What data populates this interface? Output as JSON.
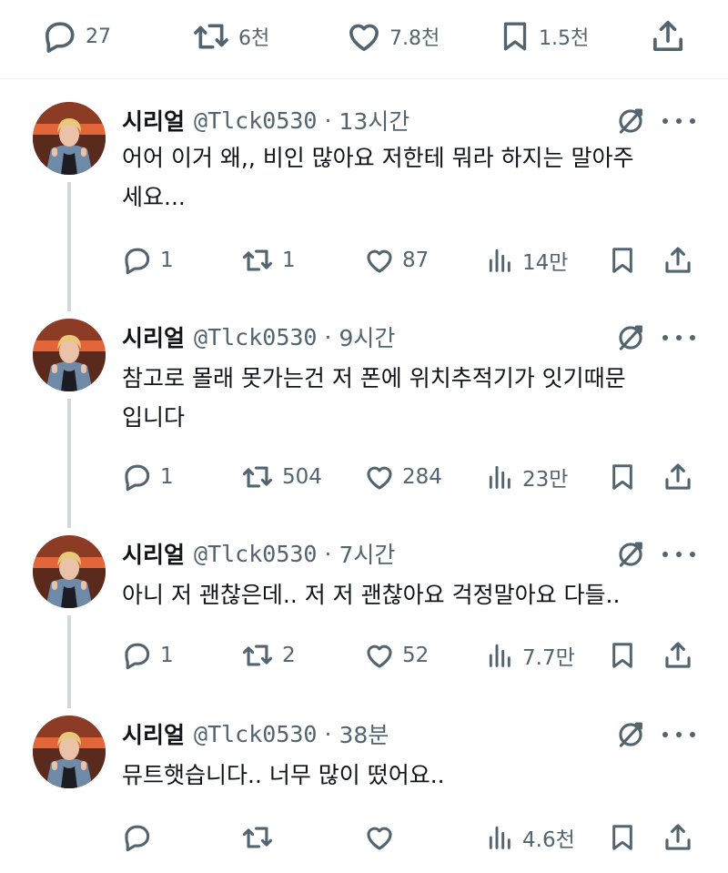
{
  "top_actions": {
    "replies": "27",
    "reposts": "6천",
    "likes": "7.8천",
    "bookmarks": "1.5천"
  },
  "tweets": [
    {
      "name": "시리얼",
      "handle": "@Tlck0530",
      "time": "13시간",
      "text_line1": "어어 이거 왜,, 비인 많아요 저한테 뭐라 하지는 말아주",
      "text_line2": "세요...",
      "replies": "1",
      "reposts": "1",
      "likes": "87",
      "views": "14만"
    },
    {
      "name": "시리얼",
      "handle": "@Tlck0530",
      "time": "9시간",
      "text_line1": "참고로 몰래 못가는건 저 폰에 위치추적기가 잇기때문",
      "text_line2": "입니다",
      "replies": "1",
      "reposts": "504",
      "likes": "284",
      "views": "23만"
    },
    {
      "name": "시리얼",
      "handle": "@Tlck0530",
      "time": "7시간",
      "text_line1": "아니 저 괜찮은데.. 저 저 괜찮아요 걱정말아요 다들..",
      "text_line2": "",
      "replies": "1",
      "reposts": "2",
      "likes": "52",
      "views": "7.7만"
    },
    {
      "name": "시리얼",
      "handle": "@Tlck0530",
      "time": "38분",
      "text_line1": "뮤트햇습니다.. 너무 많이 떴어요..",
      "text_line2": "",
      "replies": "",
      "reposts": "",
      "likes": "",
      "views": "4.6천"
    }
  ],
  "separator": "·",
  "icons": [
    "reply-icon",
    "repost-icon",
    "like-icon",
    "bookmark-icon",
    "share-icon",
    "views-icon",
    "grok-icon",
    "more-icon"
  ],
  "colors": {
    "text": "#0f1419",
    "muted": "#536471",
    "thread_line": "#cfd9de"
  }
}
